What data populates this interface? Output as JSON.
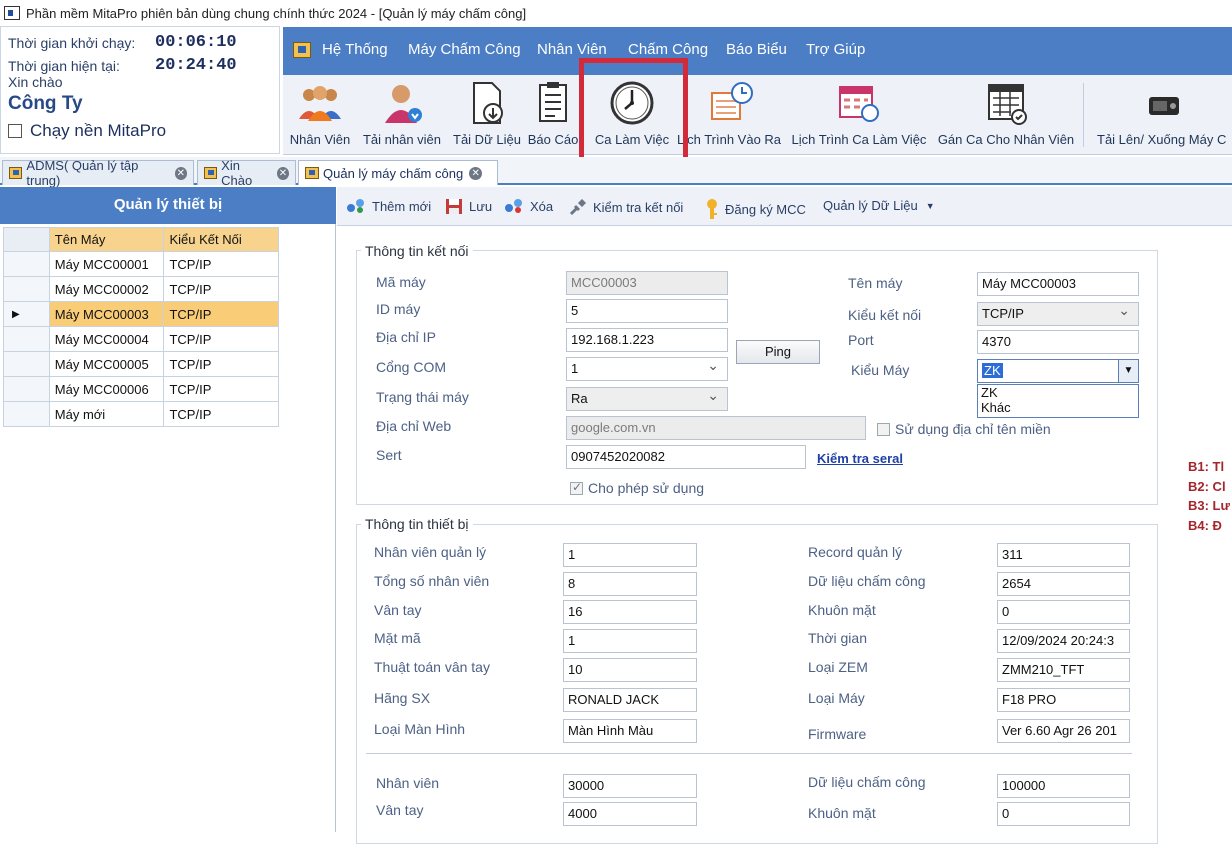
{
  "window": {
    "title": "Phần mềm MitaPro phiên bản dùng chung chính thức 2024 - [Quản lý máy chấm công]"
  },
  "info": {
    "start_label": "Thời gian khởi chạy:",
    "start_value": "00:06:10",
    "now_label": "Thời gian hiện tại:",
    "now_value": "20:24:40",
    "greeting": "Xin chào",
    "company": "Công Ty",
    "bg_run_label": "Chạy nền MitaPro",
    "bg_run_checked": false
  },
  "menu": [
    "Hệ Thống",
    "Máy Chấm Công",
    "Nhân Viên",
    "Chấm Công",
    "Báo Biểu",
    "Trợ Giúp"
  ],
  "toolbar": [
    {
      "label": "Nhân Viên",
      "icon": "employees-icon"
    },
    {
      "label": "Tải nhân viên",
      "icon": "download-employee-icon"
    },
    {
      "label": "Tải Dữ Liệu",
      "icon": "download-data-icon"
    },
    {
      "label": "Báo Cáo",
      "icon": "report-clipboard-icon"
    },
    {
      "label": "Ca Làm Việc",
      "icon": "clock-icon"
    },
    {
      "label": "Lịch Trình Vào Ra",
      "icon": "schedule-clock-icon"
    },
    {
      "label": "Lịch Trình Ca Làm Việc",
      "icon": "calendar-shift-icon"
    },
    {
      "label": "Gán Ca Cho Nhân Viên",
      "icon": "calendar-assign-icon"
    },
    {
      "label": "Tải Lên/ Xuống Máy C",
      "icon": "device-transfer-icon"
    }
  ],
  "tabs": [
    {
      "label": "ADMS( Quản lý tập trung)",
      "active": false
    },
    {
      "label": "Xin Chào",
      "active": false
    },
    {
      "label": "Quản lý máy chấm công",
      "active": true
    }
  ],
  "device_panel": {
    "title": "Quản lý thiết bị",
    "columns": [
      "Tên Máy",
      "Kiểu Kết Nối"
    ],
    "rows": [
      {
        "name": "Máy MCC00001",
        "conn": "TCP/IP"
      },
      {
        "name": "Máy MCC00002",
        "conn": "TCP/IP"
      },
      {
        "name": "Máy MCC00003",
        "conn": "TCP/IP"
      },
      {
        "name": "Máy MCC00004",
        "conn": "TCP/IP"
      },
      {
        "name": "Máy MCC00005",
        "conn": "TCP/IP"
      },
      {
        "name": "Máy MCC00006",
        "conn": "TCP/IP"
      },
      {
        "name": "Máy mới",
        "conn": "TCP/IP"
      }
    ],
    "selected_index": 2
  },
  "actions": [
    "Thêm mới",
    "Lưu",
    "Xóa",
    "Kiểm tra kết nối",
    "Đăng ký MCC",
    "Quản lý Dữ Liệu"
  ],
  "connection": {
    "title": "Thông tin kết nối",
    "ma_may_label": "Mã máy",
    "ma_may": "MCC00003",
    "id_may_label": "ID máy",
    "id_may": "5",
    "ip_label": "Địa chỉ IP",
    "ip": "192.168.1.223",
    "ping_label": "Ping",
    "com_label": "Cổng COM",
    "com": "1",
    "status_label": "Trạng thái máy",
    "status": "Ra",
    "web_label": "Địa chỉ Web",
    "web": "google.com.vn",
    "domain_label": "Sử dụng địa chỉ tên miền",
    "domain_checked": false,
    "serial_label": "Sert",
    "serial": "0907452020082",
    "check_serial_label": "Kiểm tra seral",
    "allow_label": "Cho phép sử dụng",
    "allow_checked": true,
    "ten_may_label": "Tên máy",
    "ten_may": "Máy MCC00003",
    "kieu_ket_noi_label": "Kiểu kết nối",
    "kieu_ket_noi": "TCP/IP",
    "port_label": "Port",
    "port": "4370",
    "kieu_may_label": "Kiểu Máy",
    "kieu_may": "ZK",
    "kieu_may_options": [
      "ZK",
      "Khác"
    ]
  },
  "device_info": {
    "title": "Thông tin thiết bị",
    "left": [
      {
        "label": "Nhân viên quản lý",
        "value": "1"
      },
      {
        "label": "Tổng số nhân viên",
        "value": "8"
      },
      {
        "label": "Vân tay",
        "value": "16"
      },
      {
        "label": "Mặt mã",
        "value": "1"
      },
      {
        "label": "Thuật toán vân tay",
        "value": "10"
      },
      {
        "label": "Hãng SX",
        "value": "RONALD JACK"
      },
      {
        "label": "Loại Màn Hình",
        "value": "Màn Hình Màu"
      }
    ],
    "right": [
      {
        "label": "Record quản lý",
        "value": "311"
      },
      {
        "label": "Dữ liệu chấm công",
        "value": "2654"
      },
      {
        "label": "Khuôn mặt",
        "value": "0"
      },
      {
        "label": "Thời gian",
        "value": "12/09/2024 20:24:3"
      },
      {
        "label": "Loại ZEM",
        "value": "ZMM210_TFT"
      },
      {
        "label": "Loại Máy",
        "value": "F18 PRO"
      },
      {
        "label": "Firmware",
        "value": "Ver 6.60 Agr 26 201"
      }
    ],
    "cap_left": [
      {
        "label": "Nhân viên",
        "value": "30000"
      },
      {
        "label": "Vân tay",
        "value": "4000"
      }
    ],
    "cap_right": [
      {
        "label": "Dữ liệu chấm công",
        "value": "100000"
      },
      {
        "label": "Khuôn mặt",
        "value": "0"
      }
    ]
  },
  "steps": [
    "B1: Tl",
    "B2: Cl",
    "B3: Lư",
    "B4: Đ"
  ],
  "colors": {
    "menu_blue": "#4b7ec5",
    "highlight_red": "#d32a3a",
    "row_selected": "#f9cc78",
    "header_orange": "#f7d38e"
  }
}
